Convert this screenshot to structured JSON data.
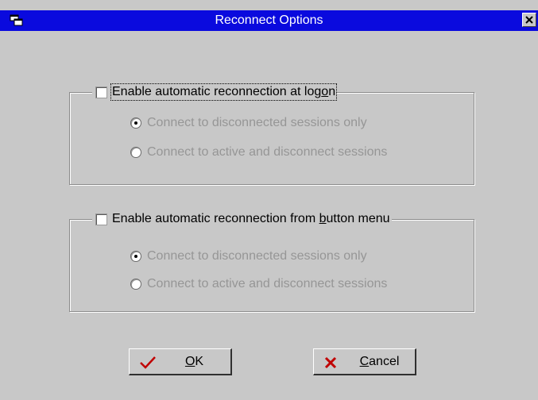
{
  "window": {
    "title": "Reconnect Options",
    "title_bar_color": "#0a0ade"
  },
  "logon_group": {
    "checkbox_label_pre": "Enable automatic reconnection at log",
    "checkbox_label_accel": "o",
    "checkbox_label_post": "n",
    "checked": false,
    "options": [
      {
        "label": "Connect to disconnected sessions only",
        "selected": true
      },
      {
        "label": "Connect to active and disconnect sessions",
        "selected": false
      }
    ]
  },
  "button_menu_group": {
    "checkbox_label_pre": "Enable automatic reconnection from ",
    "checkbox_label_accel": "b",
    "checkbox_label_post": "utton menu",
    "checked": false,
    "options": [
      {
        "label": "Connect to disconnected sessions only",
        "selected": true
      },
      {
        "label": "Connect to active and disconnect sessions",
        "selected": false
      }
    ]
  },
  "buttons": {
    "ok_accel": "O",
    "ok_rest": "K",
    "ok_icon": "checkmark-icon",
    "cancel_accel": "C",
    "cancel_rest": "ancel",
    "cancel_icon": "x-icon"
  },
  "colors": {
    "dialog_bg": "#c8c8c8",
    "disabled_text": "#969696",
    "check_red": "#c00000"
  }
}
